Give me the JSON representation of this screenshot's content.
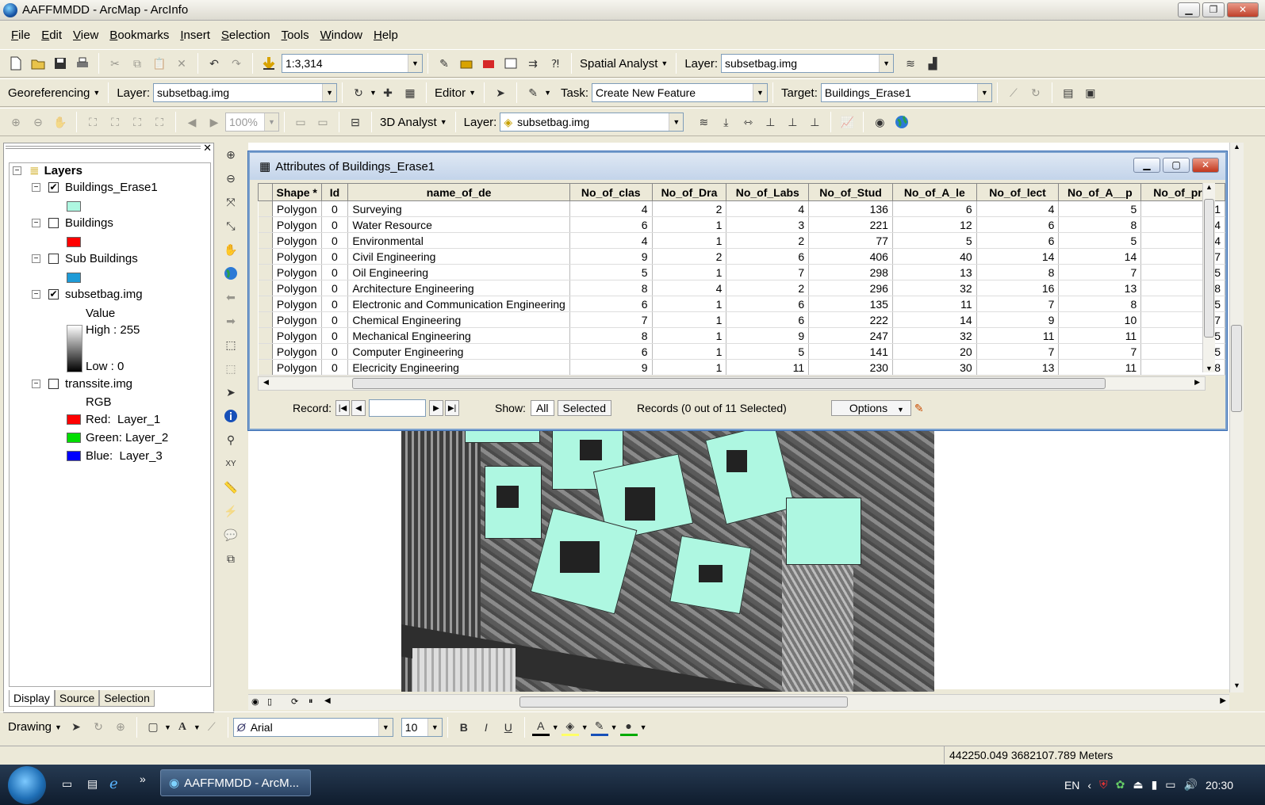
{
  "window": {
    "title": "AAFFMMDD - ArcMap - ArcInfo"
  },
  "menu": [
    "File",
    "Edit",
    "View",
    "Bookmarks",
    "Insert",
    "Selection",
    "Tools",
    "Window",
    "Help"
  ],
  "standard_toolbar": {
    "scale": "1:3,314",
    "spatial_analyst": "Spatial Analyst",
    "layer_label": "Layer:",
    "layer_value": "subsetbag.img"
  },
  "georef_toolbar": {
    "georeferencing": "Georeferencing",
    "layer_label": "Layer:",
    "layer_value": "subsetbag.img",
    "editor": "Editor",
    "task_label": "Task:",
    "task_value": "Create New Feature",
    "target_label": "Target:",
    "target_value": "Buildings_Erase1"
  },
  "analyst_toolbar": {
    "zoom": "100%",
    "analyst": "3D Analyst",
    "layer_label": "Layer:",
    "layer_value": "subsetbag.img"
  },
  "toc": {
    "root": "Layers",
    "layers": [
      {
        "name": "Buildings_Erase1",
        "checked": true,
        "color": "#aef7e1"
      },
      {
        "name": "Buildings",
        "checked": false,
        "color": "#ff0000"
      },
      {
        "name": "Sub Buildings",
        "checked": false,
        "color": "#1e9bd7"
      },
      {
        "name": "subsetbag.img",
        "checked": true,
        "value": "Value",
        "high": "High : 255",
        "low": "Low : 0"
      },
      {
        "name": "transsite.img",
        "checked": false,
        "rgb": "RGB",
        "red_key": "Red:",
        "red": "Layer_1",
        "green_key": "Green:",
        "green": "Layer_2",
        "blue_key": "Blue:",
        "blue": "Layer_3"
      }
    ],
    "tabs": [
      "Display",
      "Source",
      "Selection"
    ]
  },
  "attr_table": {
    "title": "Attributes of Buildings_Erase1",
    "columns": [
      "Shape *",
      "Id",
      "name_of_de",
      "No_of_clas",
      "No_of_Dra",
      "No_of_Labs",
      "No_of_Stud",
      "No_of_A_le",
      "No_of_lect",
      "No_of_A__p",
      "No_of_prof"
    ],
    "rows": [
      [
        "Polygon",
        "0",
        "Surveying",
        "4",
        "2",
        "4",
        "136",
        "6",
        "4",
        "5",
        "1"
      ],
      [
        "Polygon",
        "0",
        "Water Resource",
        "6",
        "1",
        "3",
        "221",
        "12",
        "6",
        "8",
        "4"
      ],
      [
        "Polygon",
        "0",
        "Environmental",
        "4",
        "1",
        "2",
        "77",
        "5",
        "6",
        "5",
        "4"
      ],
      [
        "Polygon",
        "0",
        "Civil Engineering",
        "9",
        "2",
        "6",
        "406",
        "40",
        "14",
        "14",
        "7"
      ],
      [
        "Polygon",
        "0",
        "Oil Engineering",
        "5",
        "1",
        "7",
        "298",
        "13",
        "8",
        "7",
        "5"
      ],
      [
        "Polygon",
        "0",
        "Architecture Engineering",
        "8",
        "4",
        "2",
        "296",
        "32",
        "16",
        "13",
        "8"
      ],
      [
        "Polygon",
        "0",
        "Electronic and Communication Engineering",
        "6",
        "1",
        "6",
        "135",
        "11",
        "7",
        "8",
        "5"
      ],
      [
        "Polygon",
        "0",
        "Chemical Engineering",
        "7",
        "1",
        "6",
        "222",
        "14",
        "9",
        "10",
        "7"
      ],
      [
        "Polygon",
        "0",
        "Mechanical Engineering",
        "8",
        "1",
        "9",
        "247",
        "32",
        "11",
        "11",
        "5"
      ],
      [
        "Polygon",
        "0",
        "Computer Engineering",
        "6",
        "1",
        "5",
        "141",
        "20",
        "7",
        "7",
        "5"
      ],
      [
        "Polygon",
        "0",
        "Elecricity Engineering",
        "9",
        "1",
        "11",
        "230",
        "30",
        "13",
        "11",
        "8"
      ]
    ],
    "record_label": "Record:",
    "show_label": "Show:",
    "all": "All",
    "selected": "Selected",
    "records": "Records (0 out of 11 Selected)",
    "options": "Options"
  },
  "drawing_toolbar": {
    "drawing": "Drawing",
    "font": "Arial",
    "size": "10",
    "bold": "B",
    "italic": "I",
    "underline": "U"
  },
  "status": {
    "coords": "442250.049  3682107.789 Meters"
  },
  "taskbar": {
    "task": "AAFFMMDD - ArcM...",
    "lang": "EN",
    "time": "20:30"
  }
}
